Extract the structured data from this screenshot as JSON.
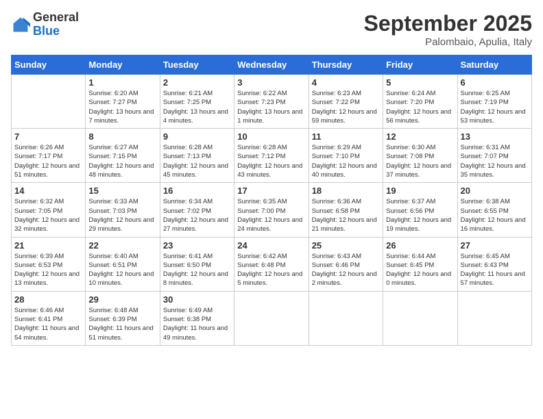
{
  "logo": {
    "general": "General",
    "blue": "Blue"
  },
  "header": {
    "month": "September 2025",
    "location": "Palombaio, Apulia, Italy"
  },
  "days_of_week": [
    "Sunday",
    "Monday",
    "Tuesday",
    "Wednesday",
    "Thursday",
    "Friday",
    "Saturday"
  ],
  "weeks": [
    [
      {
        "day": "",
        "sunrise": "",
        "sunset": "",
        "daylight": ""
      },
      {
        "day": "1",
        "sunrise": "Sunrise: 6:20 AM",
        "sunset": "Sunset: 7:27 PM",
        "daylight": "Daylight: 13 hours and 7 minutes."
      },
      {
        "day": "2",
        "sunrise": "Sunrise: 6:21 AM",
        "sunset": "Sunset: 7:25 PM",
        "daylight": "Daylight: 13 hours and 4 minutes."
      },
      {
        "day": "3",
        "sunrise": "Sunrise: 6:22 AM",
        "sunset": "Sunset: 7:23 PM",
        "daylight": "Daylight: 13 hours and 1 minute."
      },
      {
        "day": "4",
        "sunrise": "Sunrise: 6:23 AM",
        "sunset": "Sunset: 7:22 PM",
        "daylight": "Daylight: 12 hours and 59 minutes."
      },
      {
        "day": "5",
        "sunrise": "Sunrise: 6:24 AM",
        "sunset": "Sunset: 7:20 PM",
        "daylight": "Daylight: 12 hours and 56 minutes."
      },
      {
        "day": "6",
        "sunrise": "Sunrise: 6:25 AM",
        "sunset": "Sunset: 7:19 PM",
        "daylight": "Daylight: 12 hours and 53 minutes."
      }
    ],
    [
      {
        "day": "7",
        "sunrise": "Sunrise: 6:26 AM",
        "sunset": "Sunset: 7:17 PM",
        "daylight": "Daylight: 12 hours and 51 minutes."
      },
      {
        "day": "8",
        "sunrise": "Sunrise: 6:27 AM",
        "sunset": "Sunset: 7:15 PM",
        "daylight": "Daylight: 12 hours and 48 minutes."
      },
      {
        "day": "9",
        "sunrise": "Sunrise: 6:28 AM",
        "sunset": "Sunset: 7:13 PM",
        "daylight": "Daylight: 12 hours and 45 minutes."
      },
      {
        "day": "10",
        "sunrise": "Sunrise: 6:28 AM",
        "sunset": "Sunset: 7:12 PM",
        "daylight": "Daylight: 12 hours and 43 minutes."
      },
      {
        "day": "11",
        "sunrise": "Sunrise: 6:29 AM",
        "sunset": "Sunset: 7:10 PM",
        "daylight": "Daylight: 12 hours and 40 minutes."
      },
      {
        "day": "12",
        "sunrise": "Sunrise: 6:30 AM",
        "sunset": "Sunset: 7:08 PM",
        "daylight": "Daylight: 12 hours and 37 minutes."
      },
      {
        "day": "13",
        "sunrise": "Sunrise: 6:31 AM",
        "sunset": "Sunset: 7:07 PM",
        "daylight": "Daylight: 12 hours and 35 minutes."
      }
    ],
    [
      {
        "day": "14",
        "sunrise": "Sunrise: 6:32 AM",
        "sunset": "Sunset: 7:05 PM",
        "daylight": "Daylight: 12 hours and 32 minutes."
      },
      {
        "day": "15",
        "sunrise": "Sunrise: 6:33 AM",
        "sunset": "Sunset: 7:03 PM",
        "daylight": "Daylight: 12 hours and 29 minutes."
      },
      {
        "day": "16",
        "sunrise": "Sunrise: 6:34 AM",
        "sunset": "Sunset: 7:02 PM",
        "daylight": "Daylight: 12 hours and 27 minutes."
      },
      {
        "day": "17",
        "sunrise": "Sunrise: 6:35 AM",
        "sunset": "Sunset: 7:00 PM",
        "daylight": "Daylight: 12 hours and 24 minutes."
      },
      {
        "day": "18",
        "sunrise": "Sunrise: 6:36 AM",
        "sunset": "Sunset: 6:58 PM",
        "daylight": "Daylight: 12 hours and 21 minutes."
      },
      {
        "day": "19",
        "sunrise": "Sunrise: 6:37 AM",
        "sunset": "Sunset: 6:56 PM",
        "daylight": "Daylight: 12 hours and 19 minutes."
      },
      {
        "day": "20",
        "sunrise": "Sunrise: 6:38 AM",
        "sunset": "Sunset: 6:55 PM",
        "daylight": "Daylight: 12 hours and 16 minutes."
      }
    ],
    [
      {
        "day": "21",
        "sunrise": "Sunrise: 6:39 AM",
        "sunset": "Sunset: 6:53 PM",
        "daylight": "Daylight: 12 hours and 13 minutes."
      },
      {
        "day": "22",
        "sunrise": "Sunrise: 6:40 AM",
        "sunset": "Sunset: 6:51 PM",
        "daylight": "Daylight: 12 hours and 10 minutes."
      },
      {
        "day": "23",
        "sunrise": "Sunrise: 6:41 AM",
        "sunset": "Sunset: 6:50 PM",
        "daylight": "Daylight: 12 hours and 8 minutes."
      },
      {
        "day": "24",
        "sunrise": "Sunrise: 6:42 AM",
        "sunset": "Sunset: 6:48 PM",
        "daylight": "Daylight: 12 hours and 5 minutes."
      },
      {
        "day": "25",
        "sunrise": "Sunrise: 6:43 AM",
        "sunset": "Sunset: 6:46 PM",
        "daylight": "Daylight: 12 hours and 2 minutes."
      },
      {
        "day": "26",
        "sunrise": "Sunrise: 6:44 AM",
        "sunset": "Sunset: 6:45 PM",
        "daylight": "Daylight: 12 hours and 0 minutes."
      },
      {
        "day": "27",
        "sunrise": "Sunrise: 6:45 AM",
        "sunset": "Sunset: 6:43 PM",
        "daylight": "Daylight: 11 hours and 57 minutes."
      }
    ],
    [
      {
        "day": "28",
        "sunrise": "Sunrise: 6:46 AM",
        "sunset": "Sunset: 6:41 PM",
        "daylight": "Daylight: 11 hours and 54 minutes."
      },
      {
        "day": "29",
        "sunrise": "Sunrise: 6:48 AM",
        "sunset": "Sunset: 6:39 PM",
        "daylight": "Daylight: 11 hours and 51 minutes."
      },
      {
        "day": "30",
        "sunrise": "Sunrise: 6:49 AM",
        "sunset": "Sunset: 6:38 PM",
        "daylight": "Daylight: 11 hours and 49 minutes."
      },
      {
        "day": "",
        "sunrise": "",
        "sunset": "",
        "daylight": ""
      },
      {
        "day": "",
        "sunrise": "",
        "sunset": "",
        "daylight": ""
      },
      {
        "day": "",
        "sunrise": "",
        "sunset": "",
        "daylight": ""
      },
      {
        "day": "",
        "sunrise": "",
        "sunset": "",
        "daylight": ""
      }
    ]
  ]
}
